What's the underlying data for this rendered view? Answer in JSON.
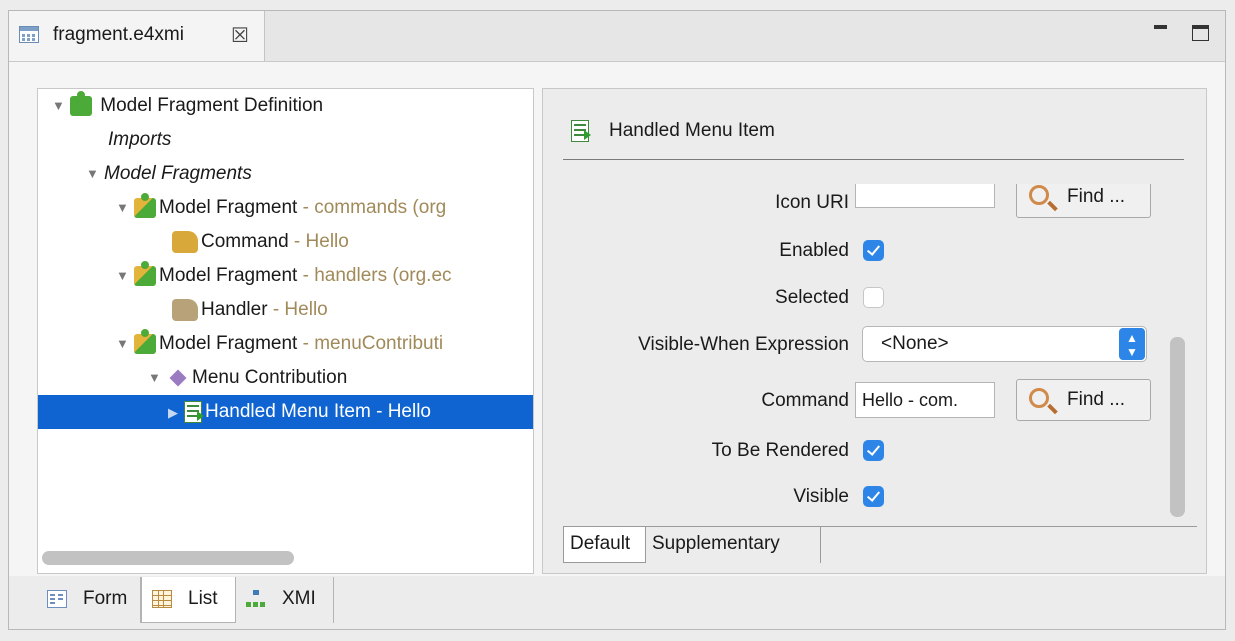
{
  "editor": {
    "tab_title": "fragment.e4xmi",
    "tab_close_glyph": "☒"
  },
  "tree": {
    "rows": [
      {
        "label": "Model Fragment Definition",
        "suffix": ""
      },
      {
        "label": "Imports",
        "suffix": ""
      },
      {
        "label": "Model Fragments",
        "suffix": ""
      },
      {
        "label": "Model Fragment",
        "suffix": " - commands (org"
      },
      {
        "label": "Command",
        "suffix": " - Hello"
      },
      {
        "label": "Model Fragment",
        "suffix": " - handlers (org.ec"
      },
      {
        "label": "Handler",
        "suffix": " - Hello"
      },
      {
        "label": "Model Fragment",
        "suffix": " - menuContributi"
      },
      {
        "label": "Menu Contribution",
        "suffix": ""
      },
      {
        "label": "Handled Menu Item - Hello",
        "suffix": ""
      }
    ]
  },
  "details": {
    "title": "Handled Menu Item",
    "fields": {
      "icon_uri": {
        "label": "Icon URI",
        "value": "",
        "button": "Find ..."
      },
      "enabled": {
        "label": "Enabled",
        "checked": true
      },
      "selected": {
        "label": "Selected",
        "checked": false
      },
      "visible_when": {
        "label": "Visible-When Expression",
        "value": "<None>"
      },
      "command": {
        "label": "Command",
        "value": "Hello - com.",
        "button": "Find ..."
      },
      "to_be_rendered": {
        "label": "To Be Rendered",
        "checked": true
      },
      "visible": {
        "label": "Visible",
        "checked": true
      }
    },
    "tabs": [
      "Default",
      "Supplementary"
    ]
  },
  "bottom_tabs": [
    "Form",
    "List",
    "XMI"
  ],
  "colors": {
    "selection": "#0f64d2",
    "checkbox_accent": "#2d86e7",
    "suffix_text": "#a18a5a"
  },
  "icons": {
    "tab": "table-icon",
    "fragment_definition": "puzzle-icon",
    "fragment": "puzzle-icon",
    "command": "gear-icon",
    "handler": "gear-icon",
    "menu_contribution": "diamond-icon",
    "handled_menu_item": "menu-item-icon",
    "find": "magnifier-icon"
  }
}
